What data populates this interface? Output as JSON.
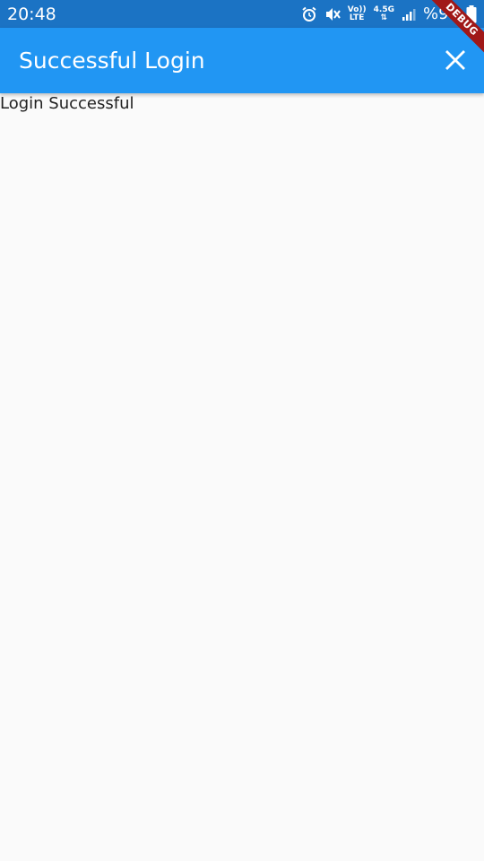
{
  "status_bar": {
    "time": "20:48",
    "signal_top": "Vo))",
    "signal_bottom": "LTE",
    "network": "4.5G",
    "battery_percent": "%96",
    "icons": [
      "alarm-icon",
      "mute-icon",
      "volte-icon",
      "network-icon",
      "signal-icon",
      "battery-icon"
    ]
  },
  "app_bar": {
    "title": "Successful Login",
    "close_icon": "close-icon"
  },
  "main": {
    "message": "Login Successful"
  },
  "debug_banner": {
    "label": "DEBUG"
  },
  "colors": {
    "status_bar": "#1b73c4",
    "app_bar": "#2196f3",
    "background": "#fafafa",
    "debug_ribbon": "#a01818"
  }
}
